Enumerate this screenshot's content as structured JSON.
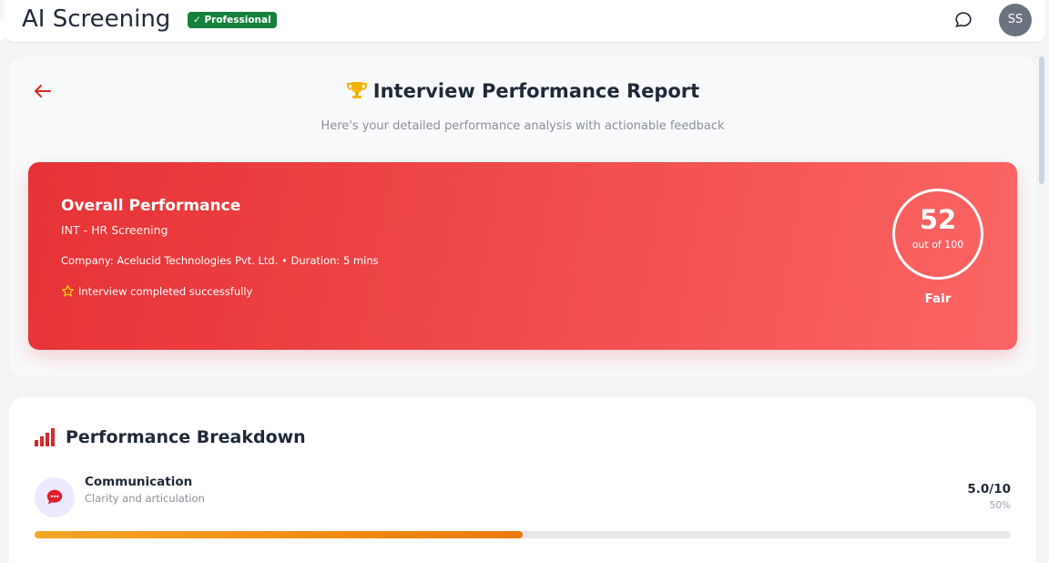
{
  "header": {
    "app_title": "AI Screening",
    "plan_badge": "✓ Professional",
    "avatar_initials": "SS"
  },
  "report": {
    "title": "Interview Performance Report",
    "subtitle": "Here's your detailed performance analysis with actionable feedback"
  },
  "overall": {
    "title": "Overall Performance",
    "interview_name": "INT - HR Screening",
    "company_line": "Company: Acelucid Technologies Pvt. Ltd. • Duration: 5 mins",
    "status": "Interview completed successfully",
    "score": "52",
    "score_out_of": "out of 100",
    "rating": "Fair"
  },
  "breakdown": {
    "title": "Performance Breakdown",
    "metrics": [
      {
        "name": "Communication",
        "description": "Clarity and articulation",
        "score": "5.0/10",
        "percent": "50%",
        "fill_fraction": 0.5
      }
    ]
  },
  "colors": {
    "accent_red": "#e63236",
    "success_green": "#15803d",
    "progress_orange": "#ec7a0c"
  }
}
